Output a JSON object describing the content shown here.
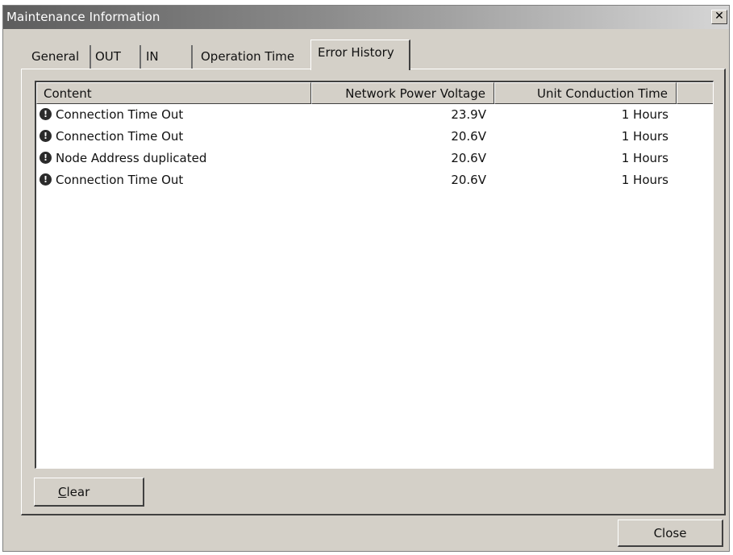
{
  "window": {
    "title": "Maintenance Information",
    "close_glyph": "✕"
  },
  "tabs": [
    {
      "label": "General"
    },
    {
      "label": "OUT"
    },
    {
      "label": "IN"
    },
    {
      "label": "Operation Time"
    },
    {
      "label": "Error History",
      "active": true
    }
  ],
  "table": {
    "columns": [
      "Content",
      "Network Power Voltage",
      "Unit Conduction Time"
    ],
    "rows": [
      {
        "icon": "error-icon",
        "content": "Connection Time Out",
        "voltage": "23.9V",
        "time": "1 Hours"
      },
      {
        "icon": "error-icon",
        "content": "Connection Time Out",
        "voltage": "20.6V",
        "time": "1 Hours"
      },
      {
        "icon": "error-icon",
        "content": "Node Address duplicated",
        "voltage": "20.6V",
        "time": "1 Hours"
      },
      {
        "icon": "error-icon",
        "content": "Connection Time Out",
        "voltage": "20.6V",
        "time": "1 Hours"
      }
    ]
  },
  "buttons": {
    "clear_label": "Clear",
    "close_label": "Close"
  },
  "colors": {
    "face": "#d4d0c8",
    "title_dark": "#5d5d5d",
    "list_bg": "#ffffff"
  }
}
